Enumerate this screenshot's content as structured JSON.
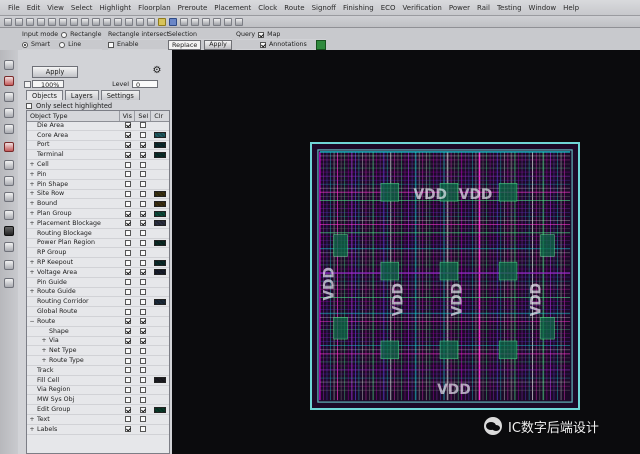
{
  "menubar": [
    "File",
    "Edit",
    "View",
    "Select",
    "Highlight",
    "Floorplan",
    "Preroute",
    "Placement",
    "Clock",
    "Route",
    "Signoff",
    "Finishing",
    "ECO",
    "Verification",
    "Power",
    "Rail",
    "Testing",
    "Window",
    "Help"
  ],
  "options": {
    "input_mode_label": "Input mode",
    "rectangle_label": "Rectangle",
    "smart_label": "Smart",
    "line_label": "Line",
    "rectangle_intersect_label": "Rectangle intersect",
    "enable_label": "Enable",
    "selection_label": "Selection",
    "selection_value": "Replace",
    "apply_small_label": "Apply",
    "query_label": "Query",
    "map_label": "Map",
    "annotations_label": "Annotations"
  },
  "panel": {
    "apply_label": "Apply",
    "zoom_value": "100%",
    "level_label": "Level",
    "level_value": "0",
    "tabs": [
      "Objects",
      "Layers",
      "Settings"
    ],
    "only_select_label": "Only select highlighted",
    "headers": {
      "object_type": "Object Type",
      "vis": "Vis",
      "sel": "Sel",
      "clr": "Clr"
    },
    "rows": [
      {
        "label": "Die Area",
        "level": 0,
        "expander": "",
        "vis": true,
        "sel": false,
        "swatch": ""
      },
      {
        "label": "Core Area",
        "level": 0,
        "expander": "",
        "vis": true,
        "sel": false,
        "swatch": "#1f5b62"
      },
      {
        "label": "Port",
        "level": 0,
        "expander": "",
        "vis": true,
        "sel": true,
        "swatch": "#0b2a2d"
      },
      {
        "label": "Terminal",
        "level": 0,
        "expander": "",
        "vis": true,
        "sel": true,
        "swatch": "#0a2d2a"
      },
      {
        "label": "Cell",
        "level": 0,
        "expander": "+",
        "vis": false,
        "sel": false,
        "swatch": ""
      },
      {
        "label": "Pin",
        "level": 0,
        "expander": "+",
        "vis": false,
        "sel": false,
        "swatch": ""
      },
      {
        "label": "Pin Shape",
        "level": 0,
        "expander": "+",
        "vis": false,
        "sel": false,
        "swatch": ""
      },
      {
        "label": "Site Row",
        "level": 0,
        "expander": "+",
        "vis": false,
        "sel": false,
        "swatch": "#3b3212"
      },
      {
        "label": "Bound",
        "level": 0,
        "expander": "+",
        "vis": false,
        "sel": false,
        "swatch": "#3c2f12"
      },
      {
        "label": "Plan Group",
        "level": 0,
        "expander": "+",
        "vis": true,
        "sel": true,
        "swatch": "#0b4a3a"
      },
      {
        "label": "Placement Blockage",
        "level": 0,
        "expander": "+",
        "vis": true,
        "sel": true,
        "swatch": "#2b2f40"
      },
      {
        "label": "Routing Blockage",
        "level": 0,
        "expander": "",
        "vis": false,
        "sel": false,
        "swatch": ""
      },
      {
        "label": "Power Plan Region",
        "level": 0,
        "expander": "",
        "vis": false,
        "sel": false,
        "swatch": "#0a2a24"
      },
      {
        "label": "RP Group",
        "level": 0,
        "expander": "",
        "vis": false,
        "sel": false,
        "swatch": ""
      },
      {
        "label": "RP Keepout",
        "level": 0,
        "expander": "+",
        "vis": false,
        "sel": false,
        "swatch": "#0a2a2a"
      },
      {
        "label": "Voltage Area",
        "level": 0,
        "expander": "+",
        "vis": true,
        "sel": true,
        "swatch": "#171d2c"
      },
      {
        "label": "Pin Guide",
        "level": 0,
        "expander": "",
        "vis": false,
        "sel": false,
        "swatch": ""
      },
      {
        "label": "Route Guide",
        "level": 0,
        "expander": "+",
        "vis": false,
        "sel": false,
        "swatch": ""
      },
      {
        "label": "Routing Corridor",
        "level": 0,
        "expander": "",
        "vis": false,
        "sel": false,
        "swatch": "#1b2a3a"
      },
      {
        "label": "Global Route",
        "level": 0,
        "expander": "",
        "vis": false,
        "sel": false,
        "swatch": ""
      },
      {
        "label": "Route",
        "level": 0,
        "expander": "−",
        "vis": true,
        "sel": true,
        "swatch": ""
      },
      {
        "label": "Shape",
        "level": 1,
        "expander": "",
        "vis": true,
        "sel": true,
        "swatch": ""
      },
      {
        "label": "Via",
        "level": 1,
        "expander": "+",
        "vis": true,
        "sel": true,
        "swatch": ""
      },
      {
        "label": "Net Type",
        "level": 1,
        "expander": "+",
        "vis": false,
        "sel": false,
        "swatch": ""
      },
      {
        "label": "Route Type",
        "level": 1,
        "expander": "+",
        "vis": false,
        "sel": false,
        "swatch": ""
      },
      {
        "label": "Track",
        "level": 0,
        "expander": "",
        "vis": false,
        "sel": false,
        "swatch": ""
      },
      {
        "label": "Fill Cell",
        "level": 0,
        "expander": "",
        "vis": false,
        "sel": false,
        "swatch": "#1c1c22"
      },
      {
        "label": "Via Region",
        "level": 0,
        "expander": "",
        "vis": false,
        "sel": false,
        "swatch": ""
      },
      {
        "label": "MW Sys Obj",
        "level": 0,
        "expander": "",
        "vis": false,
        "sel": false,
        "swatch": ""
      },
      {
        "label": "Edit Group",
        "level": 0,
        "expander": "",
        "vis": true,
        "sel": true,
        "swatch": "#0a3a2a"
      },
      {
        "label": "Text",
        "level": 0,
        "expander": "+",
        "vis": false,
        "sel": false,
        "swatch": ""
      },
      {
        "label": "Labels",
        "level": 0,
        "expander": "+",
        "vis": true,
        "sel": false,
        "swatch": ""
      }
    ]
  },
  "canvas": {
    "vdd_labels": [
      "VDD",
      "VDD",
      "VDD",
      "VDD",
      "VDD",
      "VDD",
      "VDD"
    ]
  },
  "watermark": {
    "text": "IC数字后端设计"
  }
}
